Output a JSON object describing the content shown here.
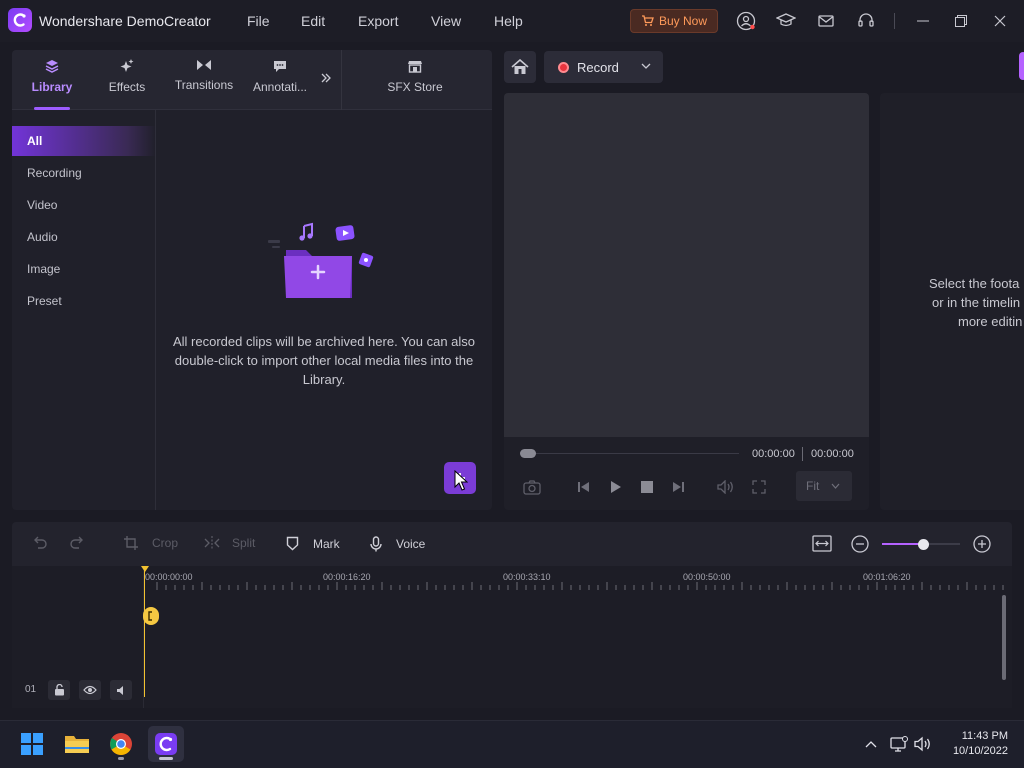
{
  "titlebar": {
    "app_title": "Wondershare DemoCreator",
    "menu": [
      "File",
      "Edit",
      "Export",
      "View",
      "Help"
    ],
    "buy_now": "Buy Now"
  },
  "library": {
    "tabs": [
      {
        "label": "Library",
        "icon": "layers-icon"
      },
      {
        "label": "Effects",
        "icon": "sparkle-icon"
      },
      {
        "label": "Transitions",
        "icon": "bowtie-icon"
      },
      {
        "label": "Annotati...",
        "icon": "comment-icon"
      }
    ],
    "sfx_store": "SFX Store",
    "sidebar": [
      "All",
      "Recording",
      "Video",
      "Audio",
      "Image",
      "Preset"
    ],
    "empty_text": "All recorded clips will be archived here. You can also double-click to import other local media files into the Library."
  },
  "recorder": {
    "record_label": "Record"
  },
  "preview": {
    "current_time": "00:00:00",
    "total_time": "00:00:00",
    "fit_label": "Fit"
  },
  "properties": {
    "hint_lines": [
      "Select the foota",
      "or in the timelin",
      "more editin"
    ]
  },
  "timeline_toolbar": {
    "crop": "Crop",
    "split": "Split",
    "mark": "Mark",
    "voice": "Voice"
  },
  "timeline": {
    "ruler_labels": [
      "00:00:00:00",
      "00:00:16:20",
      "00:00:33:10",
      "00:00:50:00",
      "00:01:06:20"
    ],
    "track_number": "01"
  },
  "taskbar": {
    "time": "11:43 PM",
    "date": "10/10/2022"
  },
  "colors": {
    "accent": "#9d5cff",
    "record": "#e8343e",
    "playhead": "#f5c842",
    "buy_now": "#ff9a5a"
  }
}
